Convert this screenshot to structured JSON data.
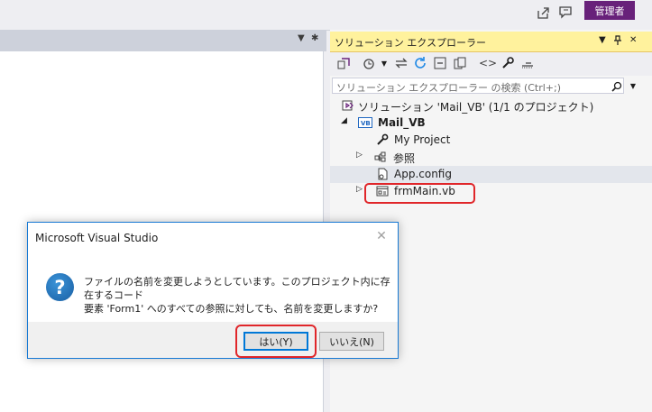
{
  "titlebar": {
    "icons": [
      "live-share-icon",
      "feedback-icon"
    ],
    "admin_badge": "管理者"
  },
  "docwell": {
    "icons": [
      "dropdown-icon",
      "gear-icon"
    ]
  },
  "solution_explorer": {
    "title": "ソリューション エクスプローラー",
    "header_buttons": [
      "dropdown-icon",
      "pin-icon",
      "close-icon"
    ],
    "toolbar_icons": [
      "switch-views-icon",
      "history-icon",
      "sync-icon",
      "refresh-icon",
      "collapse-all-icon",
      "show-all-files-icon",
      "view-code-icon",
      "properties-icon",
      "preview-icon"
    ],
    "search_placeholder": "ソリューション エクスプローラー の検索 (Ctrl+;)",
    "tree": [
      {
        "label": "ソリューション 'Mail_VB' (1/1 のプロジェクト)",
        "icon": "solution-icon"
      },
      {
        "label": "Mail_VB",
        "icon": "vb-project-icon",
        "bold": true,
        "expander": "expanded"
      },
      {
        "label": "My Project",
        "icon": "wrench-icon"
      },
      {
        "label": "参照",
        "icon": "references-icon",
        "expander": "collapsed"
      },
      {
        "label": "App.config",
        "icon": "config-file-icon",
        "selected": true
      },
      {
        "label": "frmMain.vb",
        "icon": "form-icon",
        "expander": "collapsed"
      }
    ]
  },
  "dialog": {
    "title": "Microsoft Visual Studio",
    "icon": "question-icon",
    "message_line1": "ファイルの名前を変更しようとしています。このプロジェクト内に存在するコード",
    "message_line2": "要素 'Form1' へのすべての参照に対しても、名前を変更しますか?",
    "yes_label": "はい(Y)",
    "no_label": "いいえ(N)",
    "close_glyph": "✕",
    "q_glyph": "?"
  },
  "colors": {
    "admin_badge": "#68217a",
    "se_header": "#fff29d",
    "highlight": "#e0262a",
    "dialog_border": "#1779d4"
  }
}
